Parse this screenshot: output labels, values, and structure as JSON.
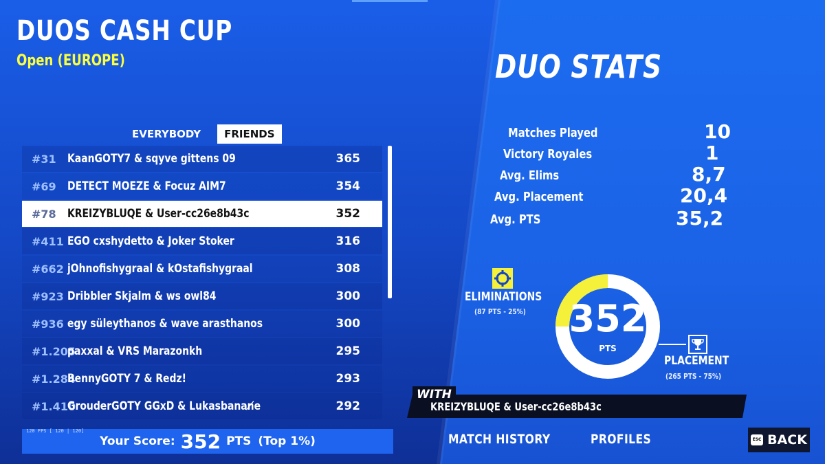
{
  "header": {
    "title": "DUOS CASH CUP",
    "subtitle": "Open (EUROPE)"
  },
  "tabs": [
    "EVERYBODY",
    "FRIENDS"
  ],
  "leaderboard": [
    {
      "rank": "#31",
      "names": "KaanGOTY7 & sqyve gittens 09",
      "points": "365"
    },
    {
      "rank": "#69",
      "names": "DETECT MOEZE & Focuz AIM7",
      "points": "354"
    },
    {
      "rank": "#78",
      "names": "KREIZYBLUQE & User-cc26e8b43c",
      "points": "352"
    },
    {
      "rank": "#411",
      "names": "EGO cxshydetto & Joker Stoker",
      "points": "316"
    },
    {
      "rank": "#662",
      "names": "jOhnofishygraal & kOstafishygraal",
      "points": "308"
    },
    {
      "rank": "#923",
      "names": "Dribbler Skjalm & ws owl84",
      "points": "300"
    },
    {
      "rank": "#936",
      "names": "egy süleythanos & wave arasthanos",
      "points": "300"
    },
    {
      "rank": "#1.205",
      "names": "paxxal & VRS Marazonkh",
      "points": "295"
    },
    {
      "rank": "#1.284",
      "names": "BennyGOTY 7 & Redz!",
      "points": "293"
    },
    {
      "rank": "#1.410",
      "names": "GrouderGOTY GGxD & Lukasbanan̸e",
      "points": "292"
    }
  ],
  "highlighted_index": 2,
  "score": {
    "label": "Your Score:",
    "value": "352",
    "unit": "PTS",
    "top": "(Top 1%)"
  },
  "fps_text": "120 FPS [ 120 | 120]",
  "duo_stats": {
    "title": "DUO STATS",
    "rows": [
      {
        "label": "Matches Played",
        "value": "10"
      },
      {
        "label": "Victory Royales",
        "value": "1"
      },
      {
        "label": "Avg. Elims",
        "value": "8,7"
      },
      {
        "label": "Avg. Placement",
        "value": "20,4"
      },
      {
        "label": "Avg. PTS",
        "value": "35,2"
      }
    ]
  },
  "ring": {
    "total": "352",
    "unit": "PTS",
    "elim_fraction": 0.25
  },
  "eliminations": {
    "label": "ELIMINATIONS",
    "detail": "(87 PTS - 25%)",
    "icon": "crosshair-icon"
  },
  "placement": {
    "label": "PLACEMENT",
    "detail": "(265 PTS - 75%)",
    "icon": "trophy-icon"
  },
  "with": {
    "label": "WITH",
    "names": "KREIZYBLUQE & User-cc26e8b43c"
  },
  "nav": {
    "match_history": "MATCH HISTORY",
    "profiles": "PROFILES",
    "back": "BACK",
    "esc": "ESC"
  },
  "colors": {
    "accent_yellow": "#f5f03a",
    "highlight_row": "#ffffff",
    "bg_blue": "#1a5ee8"
  }
}
